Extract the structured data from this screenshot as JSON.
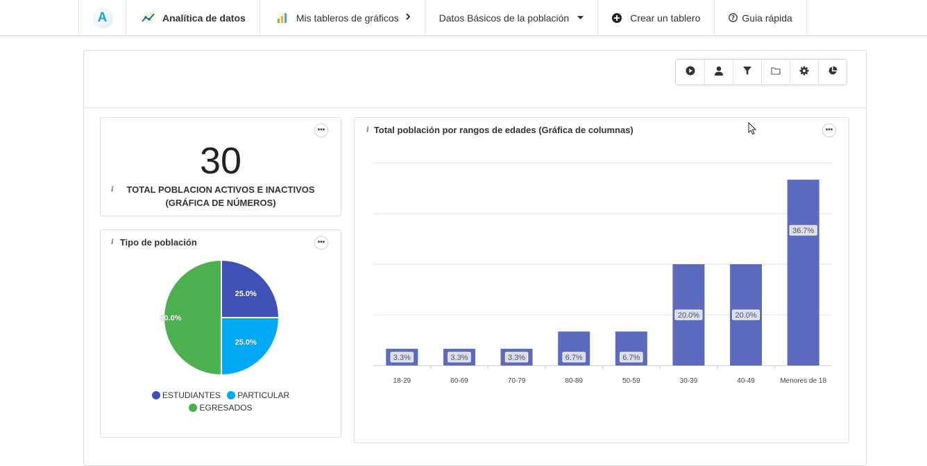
{
  "navbar": {
    "logo_letter": "A",
    "items": [
      {
        "label": "Analítica de datos"
      },
      {
        "label": "Mis tableros de gráficos"
      },
      {
        "label": "Datos Básicos de la población"
      },
      {
        "label": "Crear un tablero"
      },
      {
        "label": "Guia rápida"
      }
    ]
  },
  "toolbar": {
    "buttons": [
      "play-icon",
      "user-icon",
      "filter-icon",
      "folder-icon",
      "gear-icon",
      "pie-chart-icon"
    ]
  },
  "number_widget": {
    "value": "30",
    "label_line1": "TOTAL POBLACION ACTIVOS E INACTIVOS",
    "label_line2": "(GRÁFICA DE NÚMEROS)"
  },
  "pie_widget": {
    "title": "Tipo de población",
    "legend": [
      {
        "name": "ESTUDIANTES",
        "color": "#3f51b5"
      },
      {
        "name": "PARTICULAR",
        "color": "#03a9f4"
      },
      {
        "name": "EGRESADOS",
        "color": "#4caf50"
      }
    ]
  },
  "bar_widget": {
    "title": "Total población por rangos de edades (Gráfica de columnas)"
  },
  "chart_data": [
    {
      "type": "pie",
      "categories": [
        "ESTUDIANTES",
        "PARTICULAR",
        "EGRESADOS"
      ],
      "values": [
        25.0,
        25.0,
        50.0
      ],
      "labels": [
        "25.0%",
        "25.0%",
        "50.0%"
      ],
      "colors": [
        "#3f51b5",
        "#03a9f4",
        "#4caf50"
      ],
      "title": "Tipo de población",
      "legend": "bottom"
    },
    {
      "type": "bar",
      "categories": [
        "18-29",
        "60-69",
        "70-79",
        "80-89",
        "50-59",
        "30-39",
        "40-49",
        "Menores de 18"
      ],
      "values": [
        3.3,
        3.3,
        3.3,
        6.7,
        6.7,
        20.0,
        20.0,
        36.7
      ],
      "labels": [
        "3.3%",
        "3.3%",
        "3.3%",
        "6.7%",
        "6.7%",
        "20.0%",
        "20.0%",
        "36.7%"
      ],
      "color": "#5c6bc0",
      "title": "Total población por rangos de edades (Gráfica de columnas)",
      "xlabel": "",
      "ylabel": "",
      "ylim": [
        0,
        40
      ],
      "grid": true
    }
  ]
}
